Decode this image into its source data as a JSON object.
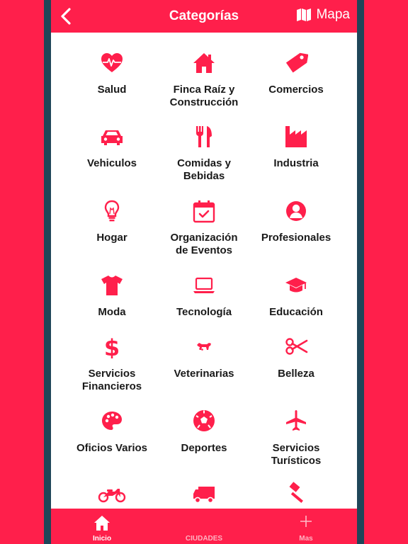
{
  "colors": {
    "accent": "#FF1F4B",
    "frame": "#1F4659",
    "text": "#1a1a1a"
  },
  "nav": {
    "title": "Categorías",
    "map_label": "Mapa",
    "back_icon": "back-arrow-icon",
    "map_icon": "map-icon"
  },
  "categories": [
    {
      "label1": "Salud",
      "label2": "",
      "icon": "heart-pulse-icon"
    },
    {
      "label1": "Finca Raíz y",
      "label2": "Construcción",
      "icon": "house-icon"
    },
    {
      "label1": "Comercios",
      "label2": "",
      "icon": "price-tag-icon"
    },
    {
      "label1": "Vehiculos",
      "label2": "",
      "icon": "car-icon"
    },
    {
      "label1": "Comidas y",
      "label2": "Bebidas",
      "icon": "fork-knife-icon"
    },
    {
      "label1": "Industria",
      "label2": "",
      "icon": "factory-icon"
    },
    {
      "label1": "Hogar",
      "label2": "",
      "icon": "light-bulb-icon"
    },
    {
      "label1": "Organización",
      "label2": "de Eventos",
      "icon": "calendar-check-icon"
    },
    {
      "label1": "Profesionales",
      "label2": "",
      "icon": "user-circle-icon"
    },
    {
      "label1": "Moda",
      "label2": "",
      "icon": "t-shirt-icon"
    },
    {
      "label1": "Tecnología",
      "label2": "",
      "icon": "laptop-icon"
    },
    {
      "label1": "Educación",
      "label2": "",
      "icon": "graduation-cap-icon"
    },
    {
      "label1": "Servicios",
      "label2": "Financieros",
      "icon": "dollar-icon"
    },
    {
      "label1": "Veterinarias",
      "label2": "",
      "icon": "dog-icon"
    },
    {
      "label1": "Belleza",
      "label2": "",
      "icon": "scissors-icon"
    },
    {
      "label1": "Oficios Varios",
      "label2": "",
      "icon": "palette-icon"
    },
    {
      "label1": "Deportes",
      "label2": "",
      "icon": "soccer-ball-icon"
    },
    {
      "label1": "Servicios",
      "label2": "Turísticos",
      "icon": "airplane-icon"
    },
    {
      "label1": "",
      "label2": "",
      "icon": "motorcycle-icon"
    },
    {
      "label1": "",
      "label2": "",
      "icon": "truck-icon"
    },
    {
      "label1": "",
      "label2": "",
      "icon": "gavel-icon"
    }
  ],
  "tabs": [
    {
      "label": "Inicio",
      "icon": "home-icon",
      "active": true
    },
    {
      "label": "CIUDADES",
      "icon": "",
      "active": false
    },
    {
      "label": "Mas",
      "icon": "plus-icon",
      "active": false
    }
  ]
}
